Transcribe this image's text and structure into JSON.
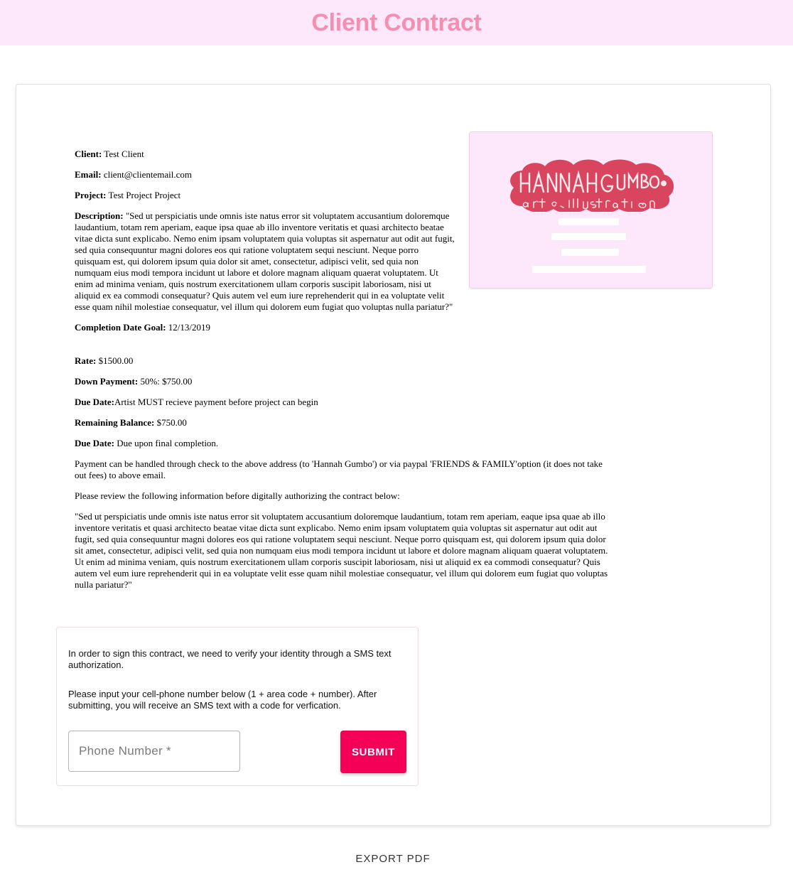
{
  "header": {
    "title": "Client Contract"
  },
  "business_card": {
    "logo_name": "HANNAH GUMBO",
    "logo_tagline": "art & illustration",
    "logo_color": "#d9455f",
    "background": "#fde8fb"
  },
  "contract": {
    "client_label": "Client:",
    "client_value": "Test Client",
    "email_label": "Email:",
    "email_value": "client@clientemail.com",
    "project_label": "Project:",
    "project_value": "Test Project Project",
    "description_label": "Description:",
    "description_value": "\"Sed ut perspiciatis unde omnis iste natus error sit voluptatem accusantium doloremque laudantium, totam rem aperiam, eaque ipsa quae ab illo inventore veritatis et quasi architecto beatae vitae dicta sunt explicabo. Nemo enim ipsam voluptatem quia voluptas sit aspernatur aut odit aut fugit, sed quia consequuntur magni dolores eos qui ratione voluptatem sequi nesciunt. Neque porro quisquam est, qui dolorem ipsum quia dolor sit amet, consectetur, adipisci velit, sed quia non numquam eius modi tempora incidunt ut labore et dolore magnam aliquam quaerat voluptatem. Ut enim ad minima veniam, quis nostrum exercitationem ullam corporis suscipit laboriosam, nisi ut aliquid ex ea commodi consequatur? Quis autem vel eum iure reprehenderit qui in ea voluptate velit esse quam nihil molestiae consequatur, vel illum qui dolorem eum fugiat quo voluptas nulla pariatur?\"",
    "completion_label": "Completion Date Goal:",
    "completion_value": "12/13/2019",
    "rate_label": "Rate:",
    "rate_value": "$1500.00",
    "down_payment_label": "Down Payment:",
    "down_payment_value": "50%: $750.00",
    "due_date_label": "Due Date:",
    "due_date_value": "Artist MUST recieve payment before project can begin",
    "remaining_label": "Remaining Balance:",
    "remaining_value": "$750.00",
    "due_date2_label": "Due Date:",
    "due_date2_value": "Due upon final completion.",
    "payment_note": "Payment can be handled through check to the above address (to 'Hannah Gumbo') or via paypal 'FRIENDS & FAMILY'option (it does not take out fees) to above email.",
    "review_note": "Please review the following information before digitally authorizing the contract below:",
    "terms_text": "\"Sed ut perspiciatis unde omnis iste natus error sit voluptatem accusantium doloremque laudantium, totam rem aperiam, eaque ipsa quae ab illo inventore veritatis et quasi architecto beatae vitae dicta sunt explicabo. Nemo enim ipsam voluptatem quia voluptas sit aspernatur aut odit aut fugit, sed quia consequuntur magni dolores eos qui ratione voluptatem sequi nesciunt. Neque porro quisquam est, qui dolorem ipsum quia dolor sit amet, consectetur, adipisci velit, sed quia non numquam eius modi tempora incidunt ut labore et dolore magnam aliquam quaerat voluptatem. Ut enim ad minima veniam, quis nostrum exercitationem ullam corporis suscipit laboriosam, nisi ut aliquid ex ea commodi consequatur? Quis autem vel eum iure reprehenderit qui in ea voluptate velit esse quam nihil molestiae consequatur, vel illum qui dolorem eum fugiat quo voluptas nulla pariatur?\""
  },
  "sms": {
    "intro": "In order to sign this contract, we need to verify your identity through a SMS text authorization.",
    "instructions": "Please input your cell-phone number below (1 + area code + number). After submitting, you will receive an SMS text with a code for verfication.",
    "phone_placeholder": "Phone Number *",
    "submit_label": "SUBMIT",
    "submit_color": "#f50057"
  },
  "footer": {
    "export_label": "EXPORT PDF"
  }
}
